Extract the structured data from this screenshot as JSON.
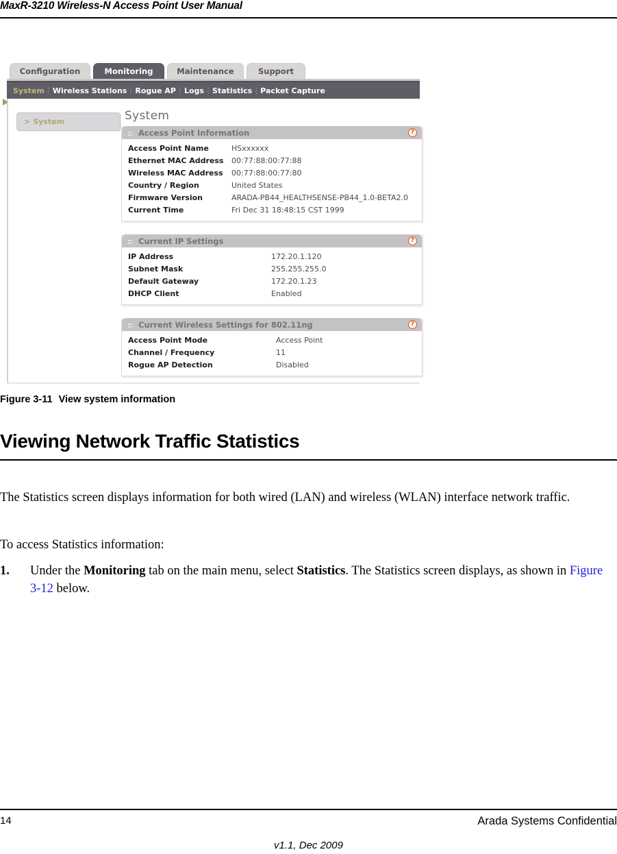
{
  "header": {
    "running_title": "MaxR-3210 Wireless-N Access Point User Manual"
  },
  "screenshot": {
    "tabs": [
      {
        "label": "Configuration",
        "active": false
      },
      {
        "label": "Monitoring",
        "active": true
      },
      {
        "label": "Maintenance",
        "active": false
      },
      {
        "label": "Support",
        "active": false
      }
    ],
    "submenu": [
      {
        "label": "System",
        "current": true
      },
      {
        "label": "Wireless Stations",
        "current": false
      },
      {
        "label": "Rogue AP",
        "current": false
      },
      {
        "label": "Logs",
        "current": false
      },
      {
        "label": "Statistics",
        "current": false
      },
      {
        "label": "Packet Capture",
        "current": false
      }
    ],
    "sidebar": {
      "chevron": ">",
      "item_label": "System"
    },
    "page_title": "System",
    "grip_icon": "::",
    "help_icon": "?",
    "panels": [
      {
        "title": "Access Point Information",
        "rows": [
          {
            "label": "Access Point Name",
            "value": "HSxxxxxx"
          },
          {
            "label": "Ethernet MAC Address",
            "value": "00:77:88:00:77:88"
          },
          {
            "label": "Wireless MAC Address",
            "value": "00:77:88:00:77:80"
          },
          {
            "label": "Country / Region",
            "value": "United States"
          },
          {
            "label": "Firmware Version",
            "value": "ARADA-PB44_HEALTHSENSE-PB44_1.0-BETA2.0"
          },
          {
            "label": "Current Time",
            "value": "Fri Dec 31 18:48:15 CST 1999"
          }
        ]
      },
      {
        "title": "Current IP Settings",
        "rows": [
          {
            "label": "IP Address",
            "value": "172.20.1.120"
          },
          {
            "label": "Subnet Mask",
            "value": "255.255.255.0"
          },
          {
            "label": "Default Gateway",
            "value": "172.20.1.23"
          },
          {
            "label": "DHCP Client",
            "value": "Enabled"
          }
        ]
      },
      {
        "title": "Current Wireless Settings for 802.11ng",
        "rows": [
          {
            "label": "Access Point Mode",
            "value": "Access Point"
          },
          {
            "label": "Channel / Frequency",
            "value": "11"
          },
          {
            "label": "Rogue AP Detection",
            "value": "Disabled"
          }
        ]
      }
    ],
    "colors": {
      "tab_active_bg": "#615d66",
      "tab_inactive_bg": "#d9d7d6",
      "submenu_bg": "#615d66",
      "submenu_current_text": "#b9bd7f",
      "panel_header_bg": "#c4c2c5",
      "help_icon_color": "#dd5a1e"
    }
  },
  "figure": {
    "number": "Figure 3-11",
    "caption": "View system information"
  },
  "section": {
    "heading": "Viewing Network Traffic Statistics"
  },
  "body": {
    "para_intro": "The Statistics screen displays information for both wired (LAN) and wireless (WLAN) interface network traffic.",
    "para_access": "To access Statistics information:",
    "steps": [
      {
        "number": "1.",
        "text_1": "Under the ",
        "bold_1": "Monitoring",
        "text_2": " tab on the main menu, select ",
        "bold_2": "Statistics",
        "text_3": ". The Statistics screen displays, as shown in ",
        "link": "Figure 3-12",
        "text_4": " below."
      }
    ]
  },
  "footer": {
    "page_number": "14",
    "confidential": "Arada Systems Confidential",
    "version": "v1.1, Dec 2009"
  }
}
